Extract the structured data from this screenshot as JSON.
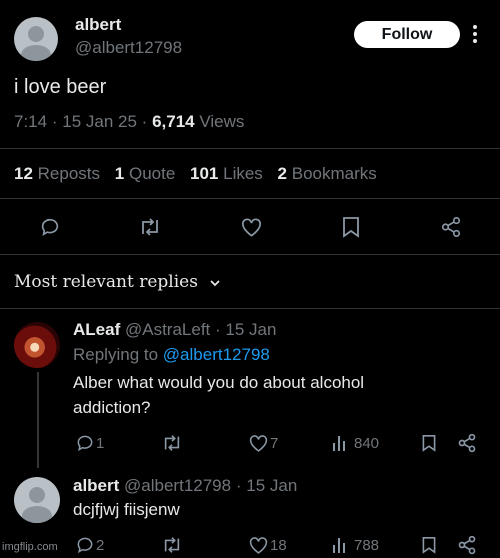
{
  "tweet": {
    "author_name": "albert",
    "author_handle": "@albert12798",
    "follow_label": "Follow",
    "text": "i love beer",
    "time": "7:14",
    "date": "15 Jan 25",
    "views_count": "6,714",
    "views_label": "Views",
    "stats": {
      "reposts_count": "12",
      "reposts_label": "Reposts",
      "quotes_count": "1",
      "quotes_label": "Quote",
      "likes_count": "101",
      "likes_label": "Likes",
      "bookmarks_count": "2",
      "bookmarks_label": "Bookmarks"
    }
  },
  "replies_header": {
    "label": "Most relevant replies"
  },
  "replies": [
    {
      "name": "ALeaf",
      "handle": "@AstraLeft",
      "date": "15 Jan",
      "replying_to_label": "Replying to",
      "replying_to_handle": "@albert12798",
      "text_line1": "Alber what would you do about alcohol",
      "text_line2": "addiction?",
      "replies": "1",
      "reposts": "",
      "likes": "7",
      "views": "840"
    },
    {
      "name": "albert",
      "handle": "@albert12798",
      "date": "15 Jan",
      "text": "dcjfjwj fiisjenw",
      "replies": "2",
      "reposts": "",
      "likes": "18",
      "views": "788"
    }
  ],
  "separator": "·",
  "watermark": "imgflip.com"
}
